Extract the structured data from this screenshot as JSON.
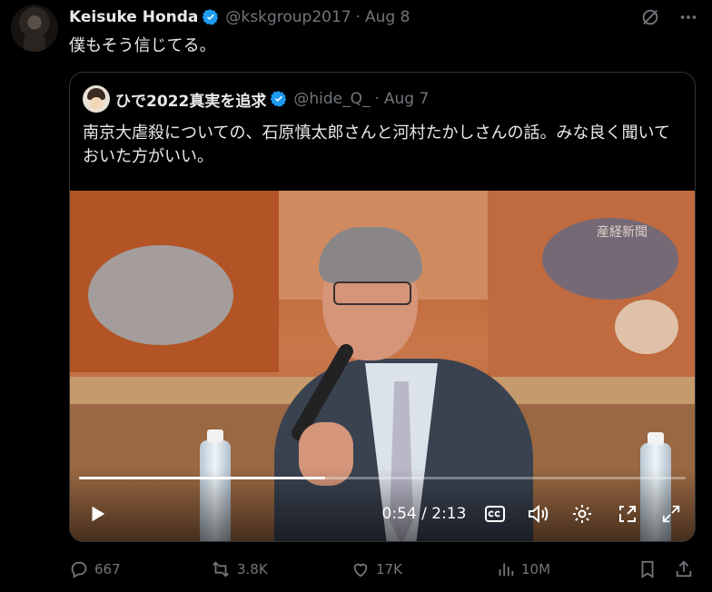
{
  "tweet": {
    "author_name": "Keisuke Honda",
    "handle": "@kskgroup2017",
    "separator": "·",
    "date": "Aug 8",
    "text": "僕もそう信じてる。"
  },
  "quoted": {
    "author_name": "ひで2022真実を追求",
    "handle": "@hide_Q_",
    "separator": "·",
    "date": "Aug 7",
    "text": "南京大虐殺についての、石原慎太郎さんと河村たかしさんの話。みな良く聞いておいた方がいい。"
  },
  "video": {
    "watermark": "産経新聞",
    "time_display": "0:54 / 2:13",
    "progress_fraction": 0.405
  },
  "actions": {
    "replies": "667",
    "reposts": "3.8K",
    "likes": "17K",
    "views": "10M"
  },
  "colors": {
    "background": "#000000",
    "text": "#e7e9ea",
    "muted": "#71767b",
    "verified": "#1d9bf0",
    "border": "#2f3336"
  }
}
